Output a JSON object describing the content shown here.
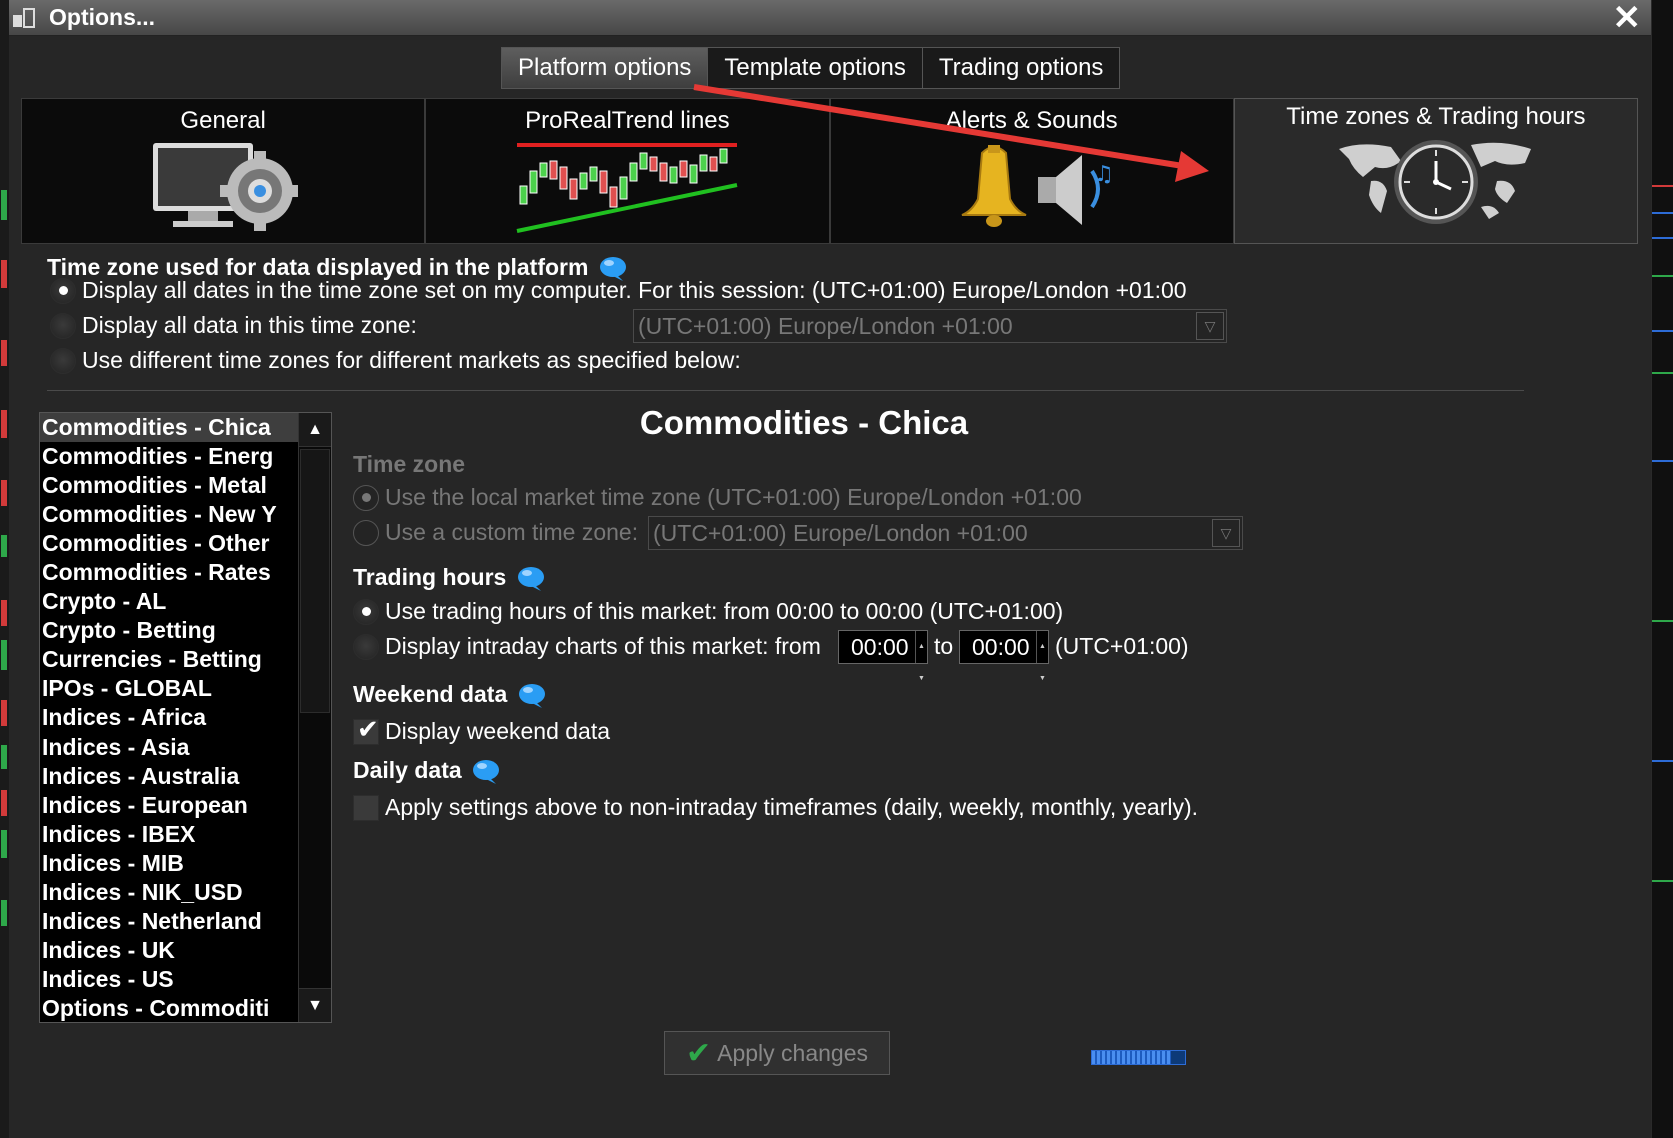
{
  "window": {
    "title": "Options..."
  },
  "top_tabs": [
    {
      "label": "Platform options",
      "active": true
    },
    {
      "label": "Template options",
      "active": false
    },
    {
      "label": "Trading options",
      "active": false
    }
  ],
  "categories": [
    {
      "label": "General",
      "icon": "monitor-gear-icon",
      "active": false
    },
    {
      "label": "ProRealTrend lines",
      "icon": "candlestick-trend-icon",
      "active": false
    },
    {
      "label": "Alerts & Sounds",
      "icon": "bell-speaker-icon",
      "active": false
    },
    {
      "label": "Time zones & Trading hours",
      "icon": "world-clock-icon",
      "active": true
    }
  ],
  "timezone_section": {
    "title": "Time zone used for data displayed in the platform",
    "options": [
      {
        "label": "Display all dates in the time zone set on my computer. For this session:  (UTC+01:00) Europe/London +01:00",
        "checked": true
      },
      {
        "label": "Display all data in this time zone:",
        "checked": false
      },
      {
        "label": "Use different time zones for different markets as specified below:",
        "checked": false
      }
    ],
    "combo_value": "(UTC+01:00) Europe/London +01:00"
  },
  "market_list": {
    "selected": "Commodities - Chica",
    "items": [
      "Commodities - Chica",
      "Commodities - Energ",
      "Commodities - Metal",
      "Commodities - New Y",
      "Commodities - Other",
      "Commodities - Rates",
      "Crypto - AL",
      "Crypto - Betting",
      "Currencies - Betting",
      "IPOs - GLOBAL",
      "Indices - Africa",
      "Indices - Asia",
      "Indices - Australia",
      "Indices - European",
      "Indices - IBEX",
      "Indices - MIB",
      "Indices - NIK_USD",
      "Indices - Netherland",
      "Indices - UK",
      "Indices - US",
      "Options - Commoditi"
    ]
  },
  "detail": {
    "title": "Commodities - Chica",
    "time_zone": {
      "heading": "Time zone",
      "local_option": "Use the local market time zone (UTC+01:00) Europe/London +01:00",
      "custom_option": "Use a custom time zone:",
      "custom_value": "(UTC+01:00) Europe/London +01:00"
    },
    "trading_hours": {
      "heading": "Trading hours",
      "market_hours_option": "Use trading hours of this market: from 00:00 to 00:00 (UTC+01:00)",
      "intraday_option": "Display intraday charts of this market: from",
      "from_value": "00:00",
      "to_label": "to",
      "to_value": "00:00",
      "tz_suffix": "(UTC+01:00)"
    },
    "weekend": {
      "heading": "Weekend data",
      "checkbox_label": "Display weekend data",
      "checked": true
    },
    "daily": {
      "heading": "Daily data",
      "checkbox_label": "Apply settings above to non-intraday timeframes (daily, weekly, monthly, yearly).",
      "checked": false
    }
  },
  "footer": {
    "apply_label": "Apply changes",
    "progress": 0.85
  },
  "colors": {
    "dialog_bg": "#262626",
    "accent_arrow": "#e53935",
    "info_icon": "#2a9df4",
    "apply_check": "#2ea84a"
  }
}
